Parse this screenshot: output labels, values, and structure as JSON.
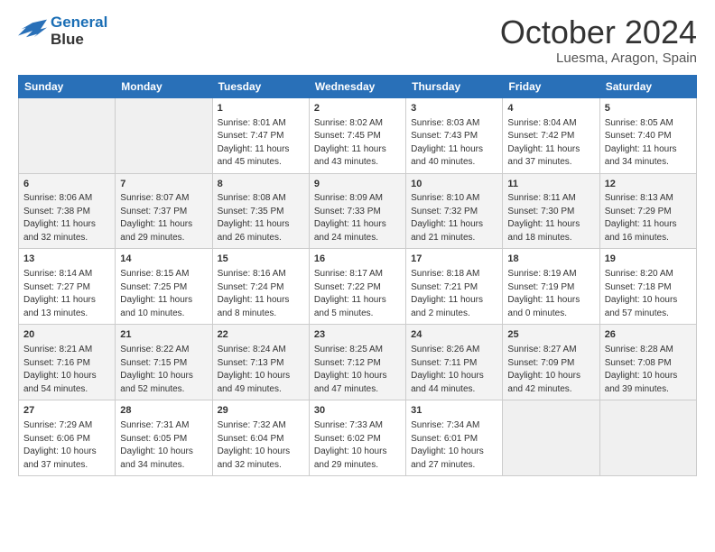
{
  "header": {
    "logo_line1": "General",
    "logo_line2": "Blue",
    "month_title": "October 2024",
    "location": "Luesma, Aragon, Spain"
  },
  "weekdays": [
    "Sunday",
    "Monday",
    "Tuesday",
    "Wednesday",
    "Thursday",
    "Friday",
    "Saturday"
  ],
  "weeks": [
    [
      {
        "day": "",
        "sunrise": "",
        "sunset": "",
        "daylight": "",
        "empty": true
      },
      {
        "day": "",
        "sunrise": "",
        "sunset": "",
        "daylight": "",
        "empty": true
      },
      {
        "day": "1",
        "sunrise": "Sunrise: 8:01 AM",
        "sunset": "Sunset: 7:47 PM",
        "daylight": "Daylight: 11 hours and 45 minutes."
      },
      {
        "day": "2",
        "sunrise": "Sunrise: 8:02 AM",
        "sunset": "Sunset: 7:45 PM",
        "daylight": "Daylight: 11 hours and 43 minutes."
      },
      {
        "day": "3",
        "sunrise": "Sunrise: 8:03 AM",
        "sunset": "Sunset: 7:43 PM",
        "daylight": "Daylight: 11 hours and 40 minutes."
      },
      {
        "day": "4",
        "sunrise": "Sunrise: 8:04 AM",
        "sunset": "Sunset: 7:42 PM",
        "daylight": "Daylight: 11 hours and 37 minutes."
      },
      {
        "day": "5",
        "sunrise": "Sunrise: 8:05 AM",
        "sunset": "Sunset: 7:40 PM",
        "daylight": "Daylight: 11 hours and 34 minutes."
      }
    ],
    [
      {
        "day": "6",
        "sunrise": "Sunrise: 8:06 AM",
        "sunset": "Sunset: 7:38 PM",
        "daylight": "Daylight: 11 hours and 32 minutes."
      },
      {
        "day": "7",
        "sunrise": "Sunrise: 8:07 AM",
        "sunset": "Sunset: 7:37 PM",
        "daylight": "Daylight: 11 hours and 29 minutes."
      },
      {
        "day": "8",
        "sunrise": "Sunrise: 8:08 AM",
        "sunset": "Sunset: 7:35 PM",
        "daylight": "Daylight: 11 hours and 26 minutes."
      },
      {
        "day": "9",
        "sunrise": "Sunrise: 8:09 AM",
        "sunset": "Sunset: 7:33 PM",
        "daylight": "Daylight: 11 hours and 24 minutes."
      },
      {
        "day": "10",
        "sunrise": "Sunrise: 8:10 AM",
        "sunset": "Sunset: 7:32 PM",
        "daylight": "Daylight: 11 hours and 21 minutes."
      },
      {
        "day": "11",
        "sunrise": "Sunrise: 8:11 AM",
        "sunset": "Sunset: 7:30 PM",
        "daylight": "Daylight: 11 hours and 18 minutes."
      },
      {
        "day": "12",
        "sunrise": "Sunrise: 8:13 AM",
        "sunset": "Sunset: 7:29 PM",
        "daylight": "Daylight: 11 hours and 16 minutes."
      }
    ],
    [
      {
        "day": "13",
        "sunrise": "Sunrise: 8:14 AM",
        "sunset": "Sunset: 7:27 PM",
        "daylight": "Daylight: 11 hours and 13 minutes."
      },
      {
        "day": "14",
        "sunrise": "Sunrise: 8:15 AM",
        "sunset": "Sunset: 7:25 PM",
        "daylight": "Daylight: 11 hours and 10 minutes."
      },
      {
        "day": "15",
        "sunrise": "Sunrise: 8:16 AM",
        "sunset": "Sunset: 7:24 PM",
        "daylight": "Daylight: 11 hours and 8 minutes."
      },
      {
        "day": "16",
        "sunrise": "Sunrise: 8:17 AM",
        "sunset": "Sunset: 7:22 PM",
        "daylight": "Daylight: 11 hours and 5 minutes."
      },
      {
        "day": "17",
        "sunrise": "Sunrise: 8:18 AM",
        "sunset": "Sunset: 7:21 PM",
        "daylight": "Daylight: 11 hours and 2 minutes."
      },
      {
        "day": "18",
        "sunrise": "Sunrise: 8:19 AM",
        "sunset": "Sunset: 7:19 PM",
        "daylight": "Daylight: 11 hours and 0 minutes."
      },
      {
        "day": "19",
        "sunrise": "Sunrise: 8:20 AM",
        "sunset": "Sunset: 7:18 PM",
        "daylight": "Daylight: 10 hours and 57 minutes."
      }
    ],
    [
      {
        "day": "20",
        "sunrise": "Sunrise: 8:21 AM",
        "sunset": "Sunset: 7:16 PM",
        "daylight": "Daylight: 10 hours and 54 minutes."
      },
      {
        "day": "21",
        "sunrise": "Sunrise: 8:22 AM",
        "sunset": "Sunset: 7:15 PM",
        "daylight": "Daylight: 10 hours and 52 minutes."
      },
      {
        "day": "22",
        "sunrise": "Sunrise: 8:24 AM",
        "sunset": "Sunset: 7:13 PM",
        "daylight": "Daylight: 10 hours and 49 minutes."
      },
      {
        "day": "23",
        "sunrise": "Sunrise: 8:25 AM",
        "sunset": "Sunset: 7:12 PM",
        "daylight": "Daylight: 10 hours and 47 minutes."
      },
      {
        "day": "24",
        "sunrise": "Sunrise: 8:26 AM",
        "sunset": "Sunset: 7:11 PM",
        "daylight": "Daylight: 10 hours and 44 minutes."
      },
      {
        "day": "25",
        "sunrise": "Sunrise: 8:27 AM",
        "sunset": "Sunset: 7:09 PM",
        "daylight": "Daylight: 10 hours and 42 minutes."
      },
      {
        "day": "26",
        "sunrise": "Sunrise: 8:28 AM",
        "sunset": "Sunset: 7:08 PM",
        "daylight": "Daylight: 10 hours and 39 minutes."
      }
    ],
    [
      {
        "day": "27",
        "sunrise": "Sunrise: 7:29 AM",
        "sunset": "Sunset: 6:06 PM",
        "daylight": "Daylight: 10 hours and 37 minutes."
      },
      {
        "day": "28",
        "sunrise": "Sunrise: 7:31 AM",
        "sunset": "Sunset: 6:05 PM",
        "daylight": "Daylight: 10 hours and 34 minutes."
      },
      {
        "day": "29",
        "sunrise": "Sunrise: 7:32 AM",
        "sunset": "Sunset: 6:04 PM",
        "daylight": "Daylight: 10 hours and 32 minutes."
      },
      {
        "day": "30",
        "sunrise": "Sunrise: 7:33 AM",
        "sunset": "Sunset: 6:02 PM",
        "daylight": "Daylight: 10 hours and 29 minutes."
      },
      {
        "day": "31",
        "sunrise": "Sunrise: 7:34 AM",
        "sunset": "Sunset: 6:01 PM",
        "daylight": "Daylight: 10 hours and 27 minutes."
      },
      {
        "day": "",
        "sunrise": "",
        "sunset": "",
        "daylight": "",
        "empty": true
      },
      {
        "day": "",
        "sunrise": "",
        "sunset": "",
        "daylight": "",
        "empty": true
      }
    ]
  ]
}
